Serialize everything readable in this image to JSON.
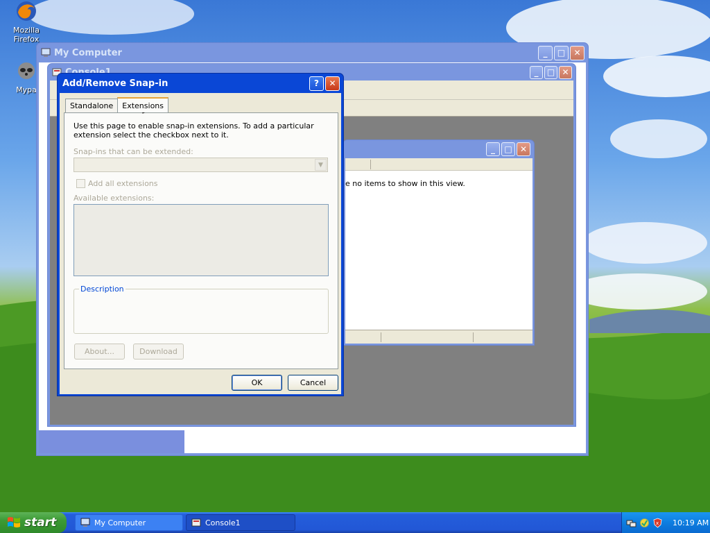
{
  "desktop": {
    "icons": [
      {
        "label": "Mozilla Firefox",
        "icon": "firefox-icon"
      },
      {
        "label": "Mypa",
        "icon": "raccoon-icon"
      }
    ]
  },
  "my_computer_window": {
    "title": "My Computer"
  },
  "console_window": {
    "title": "Console1"
  },
  "inner_window": {
    "empty_text": "e no items to show in this view."
  },
  "dialog": {
    "title": "Add/Remove Snap-in",
    "tabs": [
      {
        "label": "Standalone",
        "active": false
      },
      {
        "label": "Extensions",
        "active": true
      }
    ],
    "instructions": "Use this page to enable snap-in extensions. To add a particular extension select the checkbox next to it.",
    "snapins_label": "Snap-ins that can be extended:",
    "snapins_value": "",
    "add_all_label": "Add all extensions",
    "available_label": "Available extensions:",
    "description_label": "Description",
    "about_button": "About...",
    "download_button": "Download",
    "ok_button": "OK",
    "cancel_button": "Cancel",
    "help_glyph": "?",
    "close_glyph": "✕"
  },
  "taskbar": {
    "start_label": "start",
    "tasks": [
      {
        "label": "My Computer",
        "icon": "computer-icon",
        "state": "normal"
      },
      {
        "label": "Console1",
        "icon": "console-icon",
        "state": "pressed"
      }
    ],
    "clock": "10:19 AM",
    "tray_icons": [
      "network-icon",
      "update-icon",
      "security-shield-icon"
    ]
  },
  "colors": {
    "xp_blue": "#0a47d6",
    "start_green": "#3c9a35",
    "dialog_face": "#ece9d8"
  }
}
